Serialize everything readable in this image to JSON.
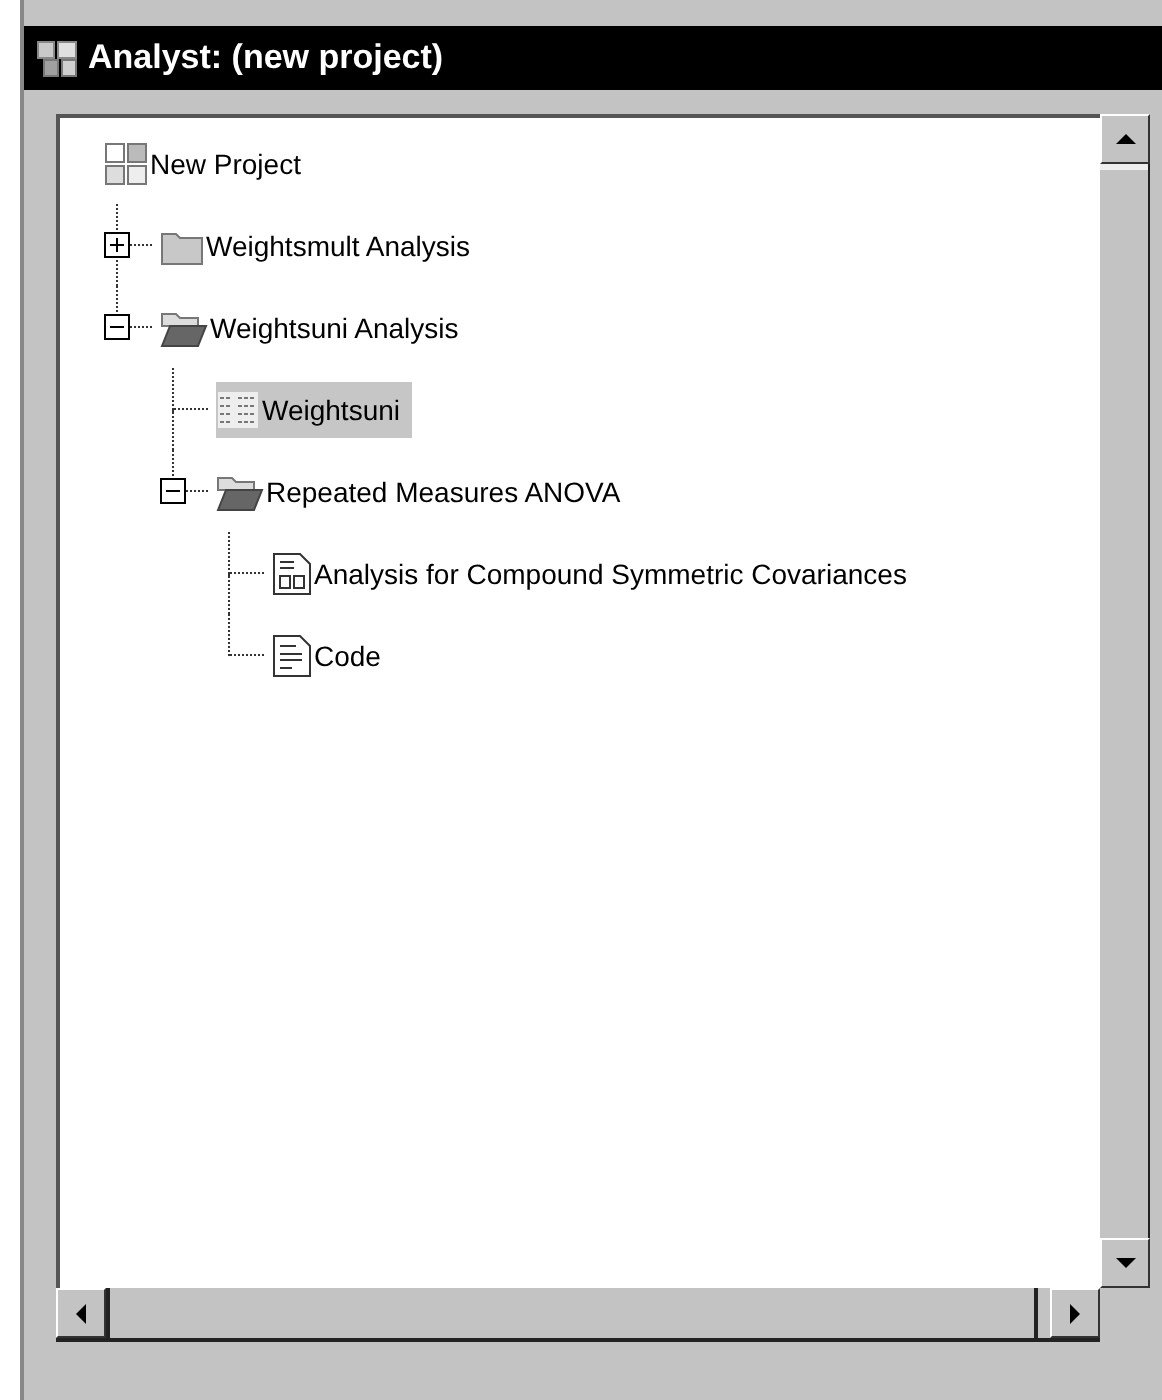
{
  "window": {
    "title": "Analyst: (new project)"
  },
  "tree": [
    {
      "label": "New Project",
      "kind": "project",
      "selected": false,
      "children": [
        {
          "label": "Weightsmult Analysis",
          "kind": "folder",
          "selected": false,
          "expanded": false
        },
        {
          "label": "Weightsuni Analysis",
          "kind": "folder",
          "selected": false,
          "expanded": true,
          "children": [
            {
              "label": "Weightsuni",
              "kind": "table",
              "selected": true
            },
            {
              "label": "Repeated Measures ANOVA",
              "kind": "folder",
              "selected": false,
              "expanded": true,
              "children": [
                {
                  "label": "Analysis for Compound Symmetric Covariances",
                  "kind": "report",
                  "selected": false
                },
                {
                  "label": "Code",
                  "kind": "code",
                  "selected": false
                }
              ]
            }
          ]
        }
      ]
    }
  ]
}
